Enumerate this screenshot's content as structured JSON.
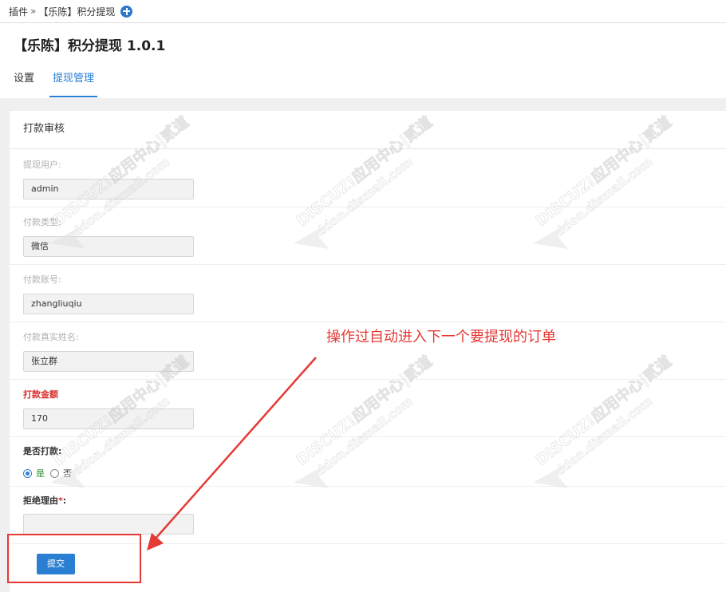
{
  "breadcrumb": {
    "root": "插件",
    "separator": "»",
    "current": "【乐陈】积分提现"
  },
  "page": {
    "title": "【乐陈】积分提现 1.0.1"
  },
  "tabs": [
    {
      "label": "设置",
      "active": false
    },
    {
      "label": "提现管理",
      "active": true
    }
  ],
  "form": {
    "section_title": "打款审核",
    "fields": {
      "user": {
        "label": "提现用户:",
        "value": "admin"
      },
      "payment_type": {
        "label": "付款类型:",
        "value": "微信"
      },
      "account": {
        "label": "付款账号:",
        "value": "zhangliuqiu"
      },
      "real_name": {
        "label": "付款真实姓名:",
        "value": "张立群"
      },
      "amount": {
        "label": "打款金额",
        "value": "170"
      },
      "paid": {
        "label": "是否打款:",
        "options": [
          {
            "label": "是",
            "checked": true
          },
          {
            "label": "否",
            "checked": false
          }
        ]
      },
      "reject_reason": {
        "label": "拒绝理由",
        "required_mark": "*",
        "label_suffix": ":",
        "value": ""
      }
    },
    "submit_label": "提交"
  },
  "annotation": {
    "text": "操作过自动进入下一个要提现的订单",
    "color": "#e53935"
  },
  "watermark": {
    "brand": "DISCUZ!",
    "cn": "应用中心",
    "domain": "addon.dismall.com",
    "tag": "贰道"
  },
  "colors": {
    "accent": "#2a7fd2",
    "required": "#d92b2b",
    "annotation": "#e53935"
  }
}
